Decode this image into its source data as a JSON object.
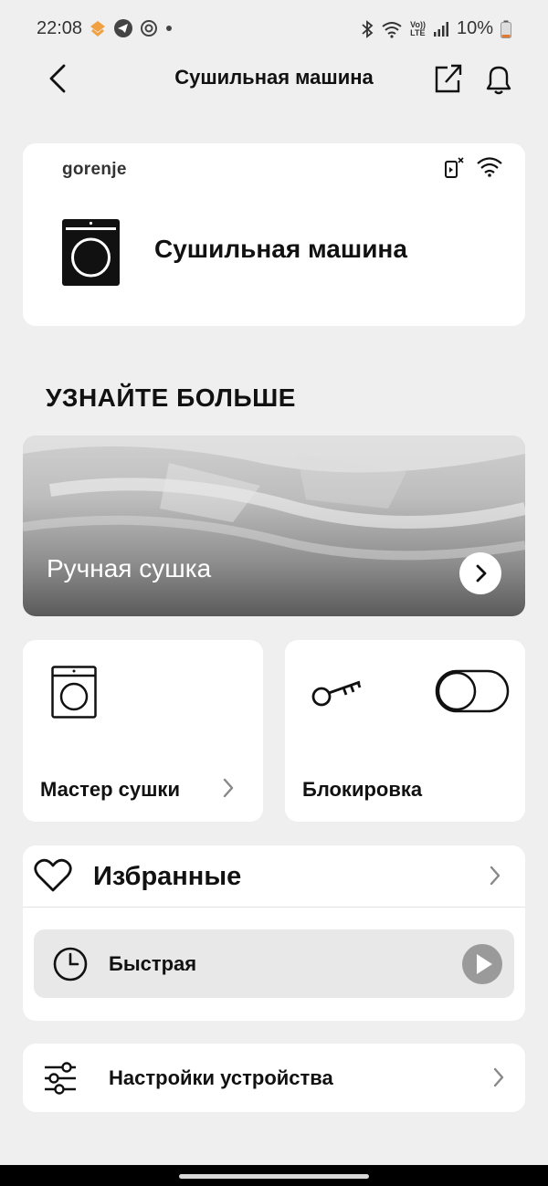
{
  "status_bar": {
    "time": "22:08",
    "battery": "10%",
    "network_label_top": "Vo))",
    "network_label_bottom": "LTE"
  },
  "header": {
    "title": "Сушильная машина"
  },
  "device_card": {
    "brand": "gorenje",
    "name": "Сушильная машина"
  },
  "learn_more": {
    "title": "УЗНАЙТЕ БОЛЬШЕ",
    "banner_label": "Ручная сушка"
  },
  "tiles": {
    "master": "Мастер сушки",
    "lock": "Блокировка",
    "lock_enabled": false
  },
  "favorites": {
    "title": "Избранные",
    "items": [
      {
        "label": "Быстрая"
      }
    ]
  },
  "settings": {
    "label": "Настройки устройства"
  },
  "colors": {
    "background": "#efefef",
    "card": "#ffffff",
    "text": "#111111",
    "favorite_item_bg": "#e8e8e8",
    "play_button": "#9a9a9a"
  }
}
